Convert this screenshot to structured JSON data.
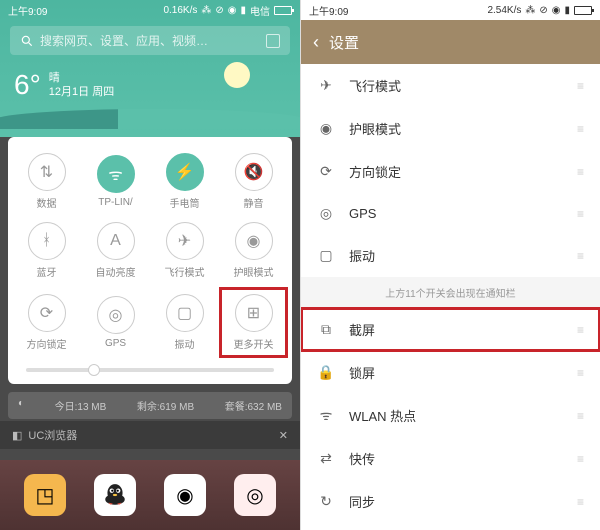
{
  "left": {
    "status": {
      "time": "上午9:09",
      "speed": "0.16K/s",
      "carrier": "电信"
    },
    "search_placeholder": "搜索网页、设置、应用、视频…",
    "weather": {
      "temp": "6°",
      "cond": "晴",
      "date": "12月1日 周四"
    },
    "tiles": [
      {
        "label": "数据",
        "icon": "data-arrows",
        "on": false
      },
      {
        "label": "TP-LIN/",
        "icon": "wifi",
        "on": true
      },
      {
        "label": "手电筒",
        "icon": "torch",
        "on": true
      },
      {
        "label": "静音",
        "icon": "mute",
        "on": false
      },
      {
        "label": "蓝牙",
        "icon": "bluetooth",
        "on": false
      },
      {
        "label": "自动亮度",
        "icon": "auto-bright",
        "on": false
      },
      {
        "label": "飞行模式",
        "icon": "airplane",
        "on": false
      },
      {
        "label": "护眼模式",
        "icon": "eye",
        "on": false
      },
      {
        "label": "方向锁定",
        "icon": "orient",
        "on": false
      },
      {
        "label": "GPS",
        "icon": "gps",
        "on": false
      },
      {
        "label": "振动",
        "icon": "vibrate",
        "on": false
      },
      {
        "label": "更多开关",
        "icon": "more",
        "on": false,
        "highlight": true
      }
    ],
    "data_strip": {
      "today": "今日:13 MB",
      "remain": "剩余:619 MB",
      "plan": "套餐:632 MB"
    },
    "uc": "UC浏览器"
  },
  "right": {
    "status": {
      "time": "上午9:09",
      "speed": "2.54K/s"
    },
    "title": "设置",
    "section_note": "上方11个开关会出现在通知栏",
    "rows": [
      {
        "label": "飞行模式",
        "icon": "airplane"
      },
      {
        "label": "护眼模式",
        "icon": "eye"
      },
      {
        "label": "方向锁定",
        "icon": "orient"
      },
      {
        "label": "GPS",
        "icon": "gps"
      },
      {
        "label": "振动",
        "icon": "vibrate"
      }
    ],
    "rows2": [
      {
        "label": "截屏",
        "icon": "screenshot",
        "highlight": true
      },
      {
        "label": "锁屏",
        "icon": "lock"
      },
      {
        "label": "WLAN 热点",
        "icon": "hotspot"
      },
      {
        "label": "快传",
        "icon": "transfer"
      },
      {
        "label": "同步",
        "icon": "sync"
      }
    ]
  }
}
